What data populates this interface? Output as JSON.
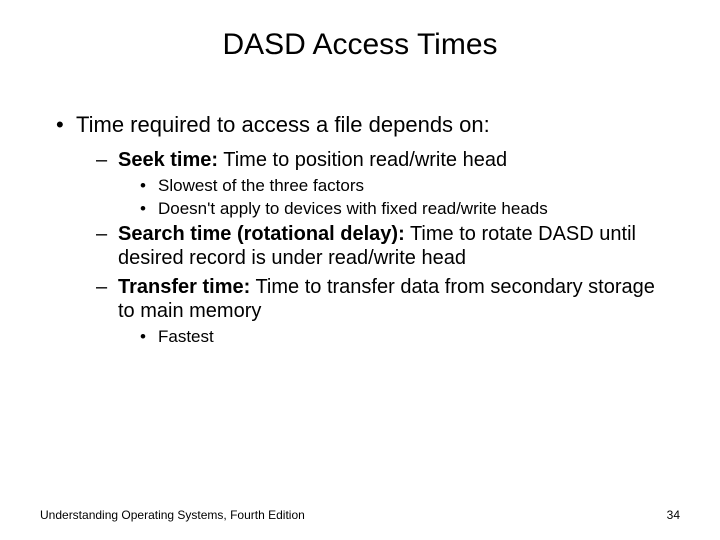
{
  "title": "DASD Access Times",
  "content": {
    "main": "Time required to access a file depends on:",
    "seek": {
      "label": "Seek time:",
      "text": " Time to position read/write head",
      "sub1": "Slowest of the three factors",
      "sub2": "Doesn't apply to devices with fixed read/write heads"
    },
    "search": {
      "label": "Search time (rotational delay):",
      "text": " Time to rotate DASD until desired record is under read/write head"
    },
    "transfer": {
      "label": "Transfer time:",
      "text": " Time to transfer data from secondary storage to main memory",
      "sub1": "Fastest"
    }
  },
  "footer": {
    "left": "Understanding Operating Systems, Fourth Edition",
    "right": "34"
  }
}
